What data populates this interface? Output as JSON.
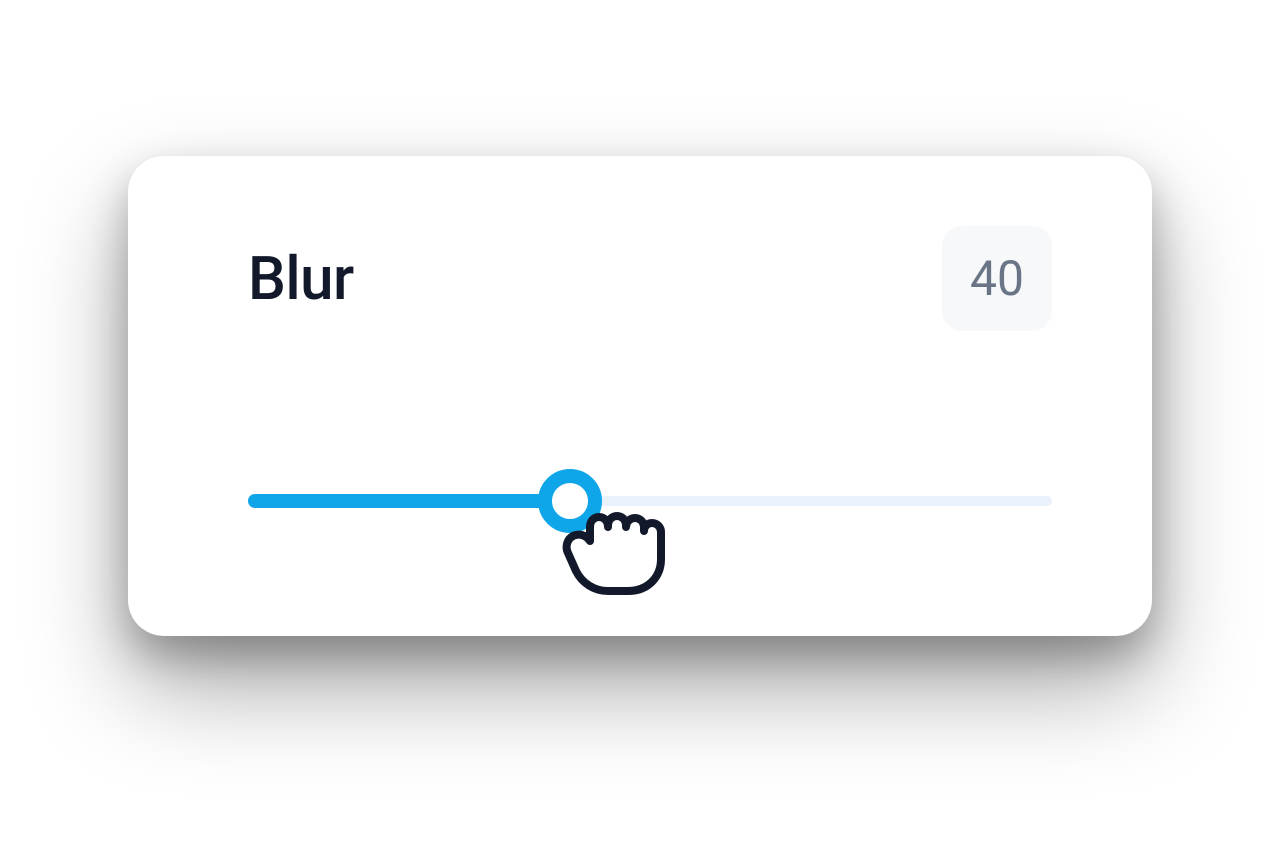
{
  "slider": {
    "label": "Blur",
    "value": 40,
    "percent": 40,
    "accent_color": "#0ea5e9",
    "track_bg_color": "#e8f1fc",
    "text_color": "#12192a",
    "value_text_color": "#697586",
    "value_bg_color": "#f6f8fa"
  }
}
